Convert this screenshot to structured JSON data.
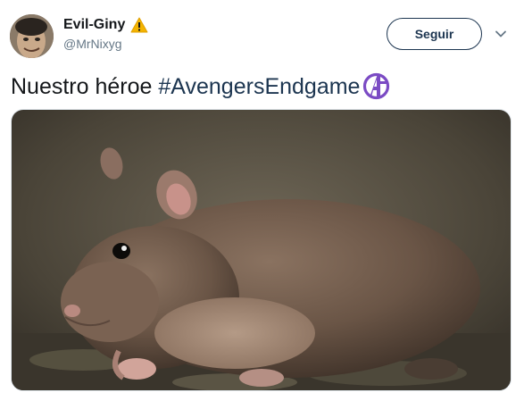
{
  "tweet": {
    "author": {
      "display_name": "Evil-Giny",
      "handle": "@MrNixyg",
      "badge_icon": "warning-icon",
      "avatar_icon": "avatar-photo"
    },
    "follow_label": "Seguir",
    "menu_icon": "chevron-down-icon",
    "text_prefix": "Nuestro héroe ",
    "hashtag": "#AvengersEndgame",
    "hashflag_icon": "avengers-logo-icon",
    "media": {
      "kind": "photo",
      "subject": "rat-photo"
    }
  },
  "colors": {
    "hashtag": "#1c3550",
    "handle": "#657786",
    "hashflag": "#7b4bc4",
    "warning": "#f4b400"
  }
}
